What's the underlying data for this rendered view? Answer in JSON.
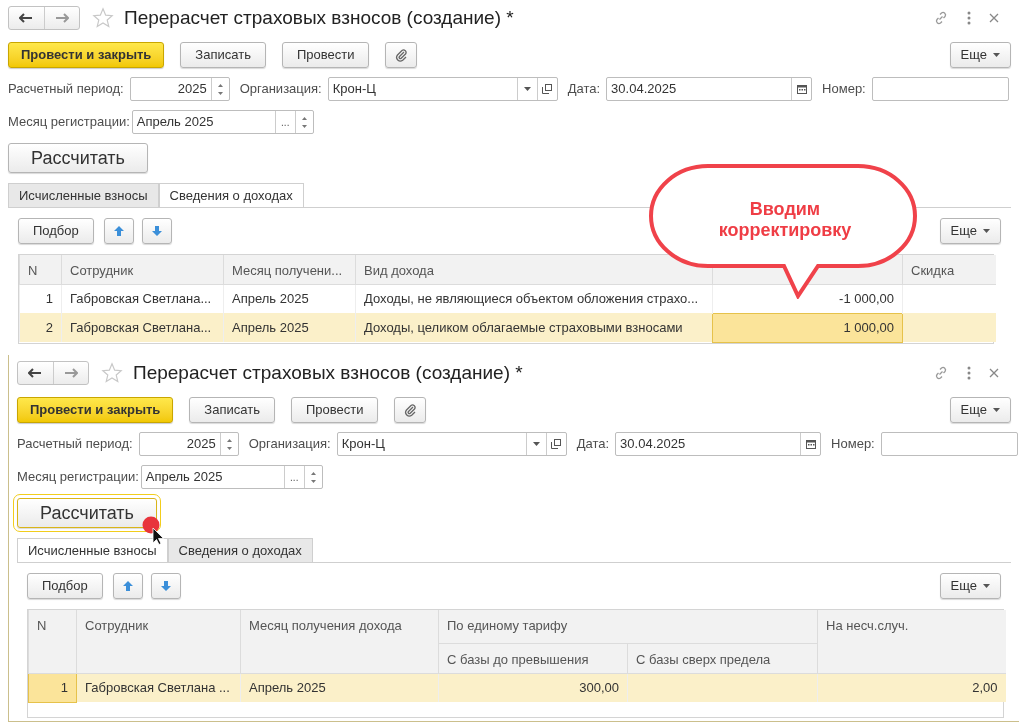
{
  "windows": [
    {
      "title": "Перерасчет страховых взносов (создание) *",
      "toolbar": {
        "buttons": [
          {
            "label": "Провести и закрыть",
            "kind": "primary"
          },
          {
            "label": "Записать",
            "kind": "default"
          },
          {
            "label": "Провести",
            "kind": "default"
          },
          {
            "kind": "attach"
          }
        ],
        "more": "Еще"
      },
      "fields": [
        {
          "label": "Расчетный период:",
          "value": "2025",
          "kind": "spin"
        },
        {
          "label": "Организация:",
          "value": "Крон-Ц",
          "kind": "select"
        },
        {
          "label": "Дата:",
          "value": "30.04.2025",
          "kind": "date"
        },
        {
          "label": "Номер:",
          "kind": "text"
        }
      ],
      "month_field": {
        "label": "Месяц регистрации:",
        "value": "Апрель 2025",
        "choose_button": "..."
      },
      "calculate_button": {
        "label": "Рассчитать",
        "focused": false,
        "clicked": false
      },
      "tabs": [
        {
          "label": "Исчисленные взносы",
          "selected": false
        },
        {
          "label": "Сведения о доходах",
          "selected": true
        }
      ],
      "table_toolbar": {
        "pick_button": "Подбор",
        "more": "Еще"
      },
      "table": {
        "columns": [
          {
            "label": "N",
            "kind": "number"
          },
          {
            "label": "Сотрудник",
            "kind": "text"
          },
          {
            "label": "Месяц получени...",
            "kind": "text"
          },
          {
            "label": "Вид дохода",
            "kind": "text"
          },
          {
            "kind": "number"
          },
          {
            "label": "Скидка",
            "kind": "number"
          }
        ],
        "rows": [
          {
            "selected": false,
            "cells": [
              {
                "text": "1",
                "focused": false
              },
              {
                "text": "Габровская Светлана...",
                "focused": false
              },
              {
                "text": "Апрель 2025",
                "focused": false
              },
              {
                "text": "Доходы, не являющиеся объектом обложения страхо...",
                "focused": false
              },
              {
                "text": "-1 000,00",
                "focused": false
              },
              {
                "focused": false
              }
            ]
          },
          {
            "selected": true,
            "cells": [
              {
                "text": "2",
                "focused": false
              },
              {
                "text": "Габровская Светлана...",
                "focused": false
              },
              {
                "text": "Апрель 2025",
                "focused": false
              },
              {
                "text": "Доходы, целиком облагаемые страховыми взносами",
                "focused": false
              },
              {
                "text": "1 000,00",
                "focused": true
              },
              {
                "focused": false
              }
            ]
          }
        ]
      },
      "callout": {
        "text": "Вводим корректировку"
      }
    },
    {
      "title": "Перерасчет страховых взносов (создание) *",
      "toolbar": {
        "buttons": [
          {
            "label": "Провести и закрыть",
            "kind": "primary"
          },
          {
            "label": "Записать",
            "kind": "default"
          },
          {
            "label": "Провести",
            "kind": "default"
          },
          {
            "kind": "attach"
          }
        ],
        "more": "Еще"
      },
      "fields": [
        {
          "label": "Расчетный период:",
          "value": "2025",
          "kind": "spin"
        },
        {
          "label": "Организация:",
          "value": "Крон-Ц",
          "kind": "select"
        },
        {
          "label": "Дата:",
          "value": "30.04.2025",
          "kind": "date"
        },
        {
          "label": "Номер:",
          "kind": "text"
        }
      ],
      "month_field": {
        "label": "Месяц регистрации:",
        "value": "Апрель 2025",
        "choose_button": "..."
      },
      "calculate_button": {
        "label": "Рассчитать",
        "focused": true,
        "clicked": true
      },
      "tabs": [
        {
          "label": "Исчисленные взносы",
          "selected": true
        },
        {
          "label": "Сведения о доходах",
          "selected": false
        }
      ],
      "table_toolbar": {
        "pick_button": "Подбор",
        "more": "Еще"
      },
      "table": {
        "columns": [
          {
            "label": "N",
            "kind": "number"
          },
          {
            "label": "Сотрудник",
            "kind": "text"
          },
          {
            "label": "Месяц получения дохода",
            "kind": "text"
          },
          {
            "label": "По единому тарифу",
            "children": [
              {
                "label": "С базы до превышения",
                "kind": "number"
              },
              {
                "label": "С базы сверх предела",
                "kind": "number"
              }
            ]
          },
          {
            "label": "На несч.случ.",
            "kind": "number"
          }
        ],
        "rows": [
          {
            "selected": true,
            "cells": [
              {
                "text": "1",
                "focused": true
              },
              {
                "text": "Габровская Светлана ...",
                "focused": false
              },
              {
                "text": "Апрель 2025",
                "focused": false
              },
              {
                "text": "300,00",
                "focused": false
              },
              {
                "focused": false
              },
              {
                "text": "2,00",
                "focused": false
              }
            ]
          }
        ]
      }
    }
  ]
}
